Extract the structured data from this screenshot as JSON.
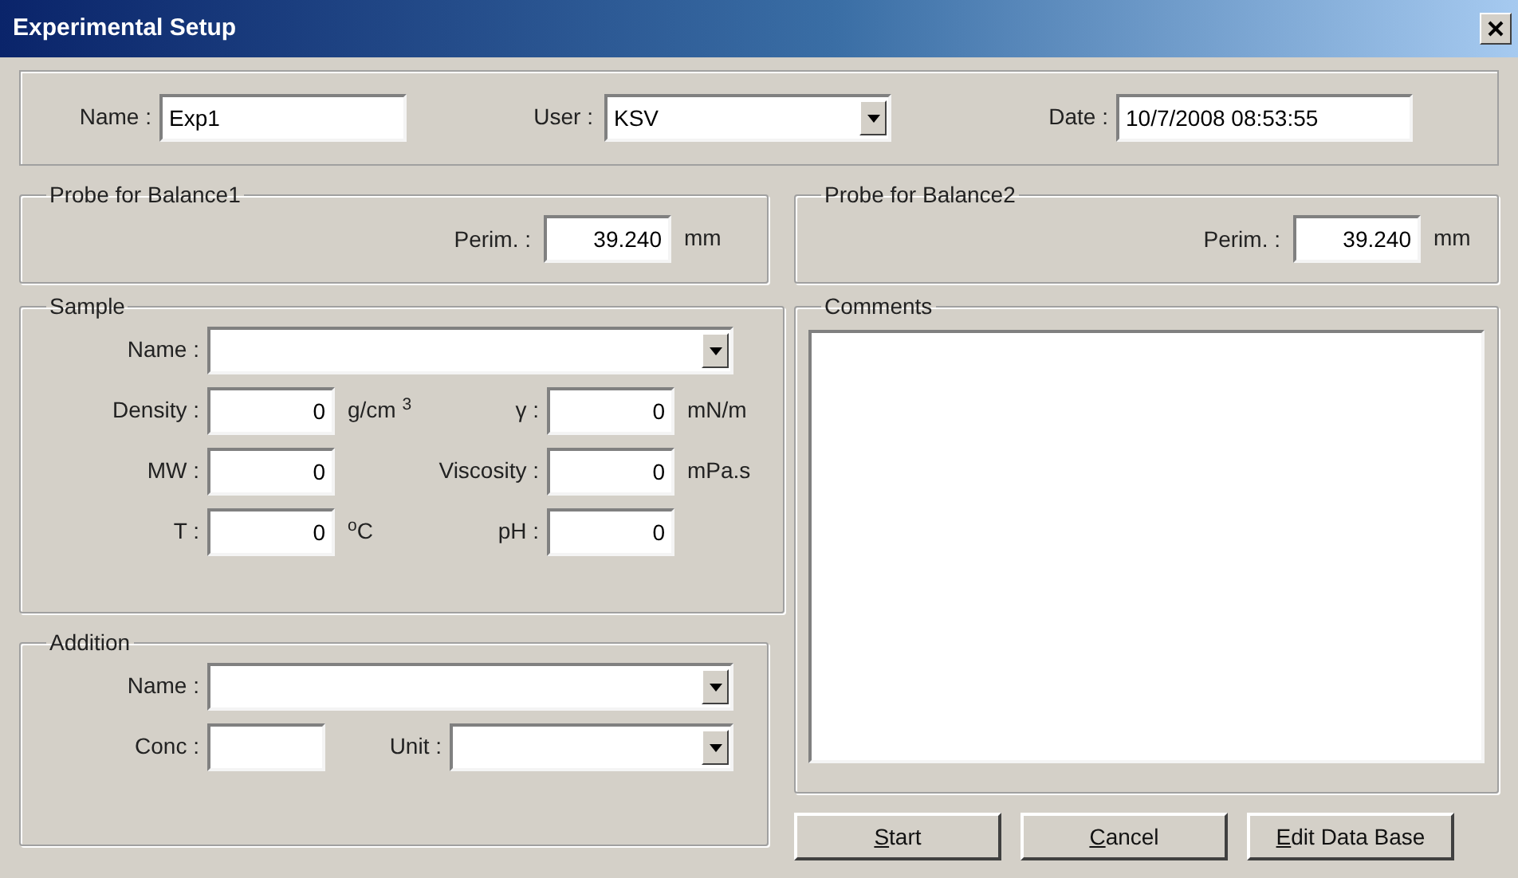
{
  "window": {
    "title": "Experimental Setup"
  },
  "header": {
    "name": {
      "label": "Name :",
      "value": "Exp1"
    },
    "user": {
      "label": "User :",
      "value": "KSV"
    },
    "date": {
      "label": "Date :",
      "value": "10/7/2008 08:53:55"
    }
  },
  "probes": [
    {
      "title": "Probe for Balance1",
      "label": "Perim. :",
      "value": "39.240",
      "unit": "mm"
    },
    {
      "title": "Probe for Balance2",
      "label": "Perim. :",
      "value": "39.240",
      "unit": "mm"
    }
  ],
  "sample": {
    "title": "Sample",
    "name_label": "Name :",
    "fields": [
      {
        "label": "Density :",
        "value": "0",
        "unit": "g/cm $^{3}$"
      },
      {
        "label": "γ :",
        "value": "0",
        "unit": "mN/m"
      },
      {
        "label": "MW :",
        "value": "0"
      },
      {
        "label": "Viscosity :",
        "value": "0",
        "unit": "mPa.s"
      },
      {
        "label": "T :",
        "value": "0",
        "unit": "$^{o}$C"
      },
      {
        "label": "pH :",
        "value": "0"
      }
    ]
  },
  "addition": {
    "title": "Addition",
    "name_label": "Name :",
    "conc_label": "Conc :",
    "unit_label": "Unit :"
  },
  "comments": {
    "title": "Comments"
  },
  "buttons": [
    {
      "label": "Start",
      "mnemonic": true
    },
    {
      "label": "Cancel",
      "mnemonic": true
    },
    {
      "label": "Edit Data Base",
      "mnemonic": true
    }
  ]
}
